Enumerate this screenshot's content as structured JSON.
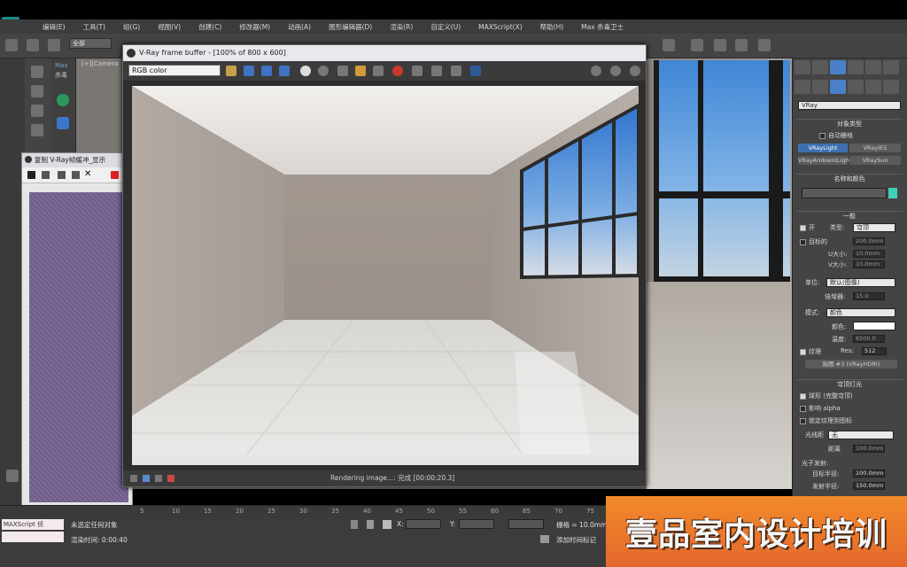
{
  "menubar": {
    "items": [
      "编辑(E)",
      "工具(T)",
      "组(G)",
      "视图(V)",
      "创建(C)",
      "修改器(M)",
      "动画(A)",
      "图形编辑器(D)",
      "渲染(R)",
      "自定义(U)",
      "MAXScript(X)",
      "帮助(H)",
      "Max 杀毒卫士"
    ]
  },
  "toolbar": {
    "filter_select": "全部"
  },
  "viewport": {
    "label": "[+][Camera"
  },
  "maxpanel": {
    "line1": "Max",
    "line2": "杀毒"
  },
  "vfb": {
    "title": "V-Ray frame buffer - [100% of 800 x 600]",
    "channel": "RGB color",
    "status": "Rendering image...: 完成 [00:00:20.3]"
  },
  "copy_window": {
    "title": "复制 V-Ray帧缓冲_显示"
  },
  "command_panel": {
    "object_dropdown": "VRay",
    "object_type_header": "对象类型",
    "autogrid_label": "自动栅格",
    "buttons": [
      "VRayLight",
      "VRayIES",
      "VRayAmbientLigh",
      "VRaySun"
    ],
    "name_color_header": "名称和颜色",
    "general_header": "一般",
    "on_label": "开",
    "type_label": "类型:",
    "type_value": "穹顶",
    "target_label": "目标的",
    "target_value": "200.0mm",
    "usize_label": "U大小:",
    "usize_value": "10.0mm",
    "vsize_label": "V大小:",
    "vsize_value": "10.0mm",
    "units_label": "单位:",
    "units_value": "默认(图像)",
    "multiplier_label": "倍增器:",
    "multiplier_value": "15.0",
    "mode_label": "模式:",
    "mode_value": "颜色",
    "color_label": "颜色:",
    "temp_label": "温度:",
    "temp_value": "6500.0",
    "texture_label": "纹理",
    "res_label": "Res:",
    "res_value": "512",
    "map_label": "贴图 #3 (VRayHDRI)",
    "dome_header": "穹顶灯光",
    "spherical_label": "球形 (完整穹顶)",
    "affect_alpha_label": "影响 alpha",
    "lock_texture_label": "锁定纹理到图标",
    "ray_label": "光线距",
    "ray_value": "无",
    "distance_label": "距离",
    "distance_value": "100.0mm",
    "photon_header": "光子发射:",
    "target_radius_label": "目标半径:",
    "target_radius_value": "100.0mm",
    "emit_radius_label": "发射半径:",
    "emit_radius_value": "150.0mm"
  },
  "statusbar": {
    "script_label": "MAXScript 侦",
    "selected_text": "未选定任何对象",
    "render_time": "渲染时间: 0:00:40",
    "x_label": "X:",
    "y_label": "Y:",
    "grid_text": "栅格 = 10.0mm",
    "add_tag": "添加时间标记"
  },
  "timeline": {
    "ticks": [
      "5",
      "10",
      "15",
      "20",
      "25",
      "30",
      "35",
      "40",
      "45",
      "50",
      "55",
      "60",
      "65",
      "70",
      "75"
    ]
  },
  "banner": {
    "text": "壹品室内设计培训"
  },
  "colors": {
    "accent_blue": "#3f73c2",
    "banner_orange": "#f0802b",
    "teal_swatch": "#3fd0b8"
  }
}
